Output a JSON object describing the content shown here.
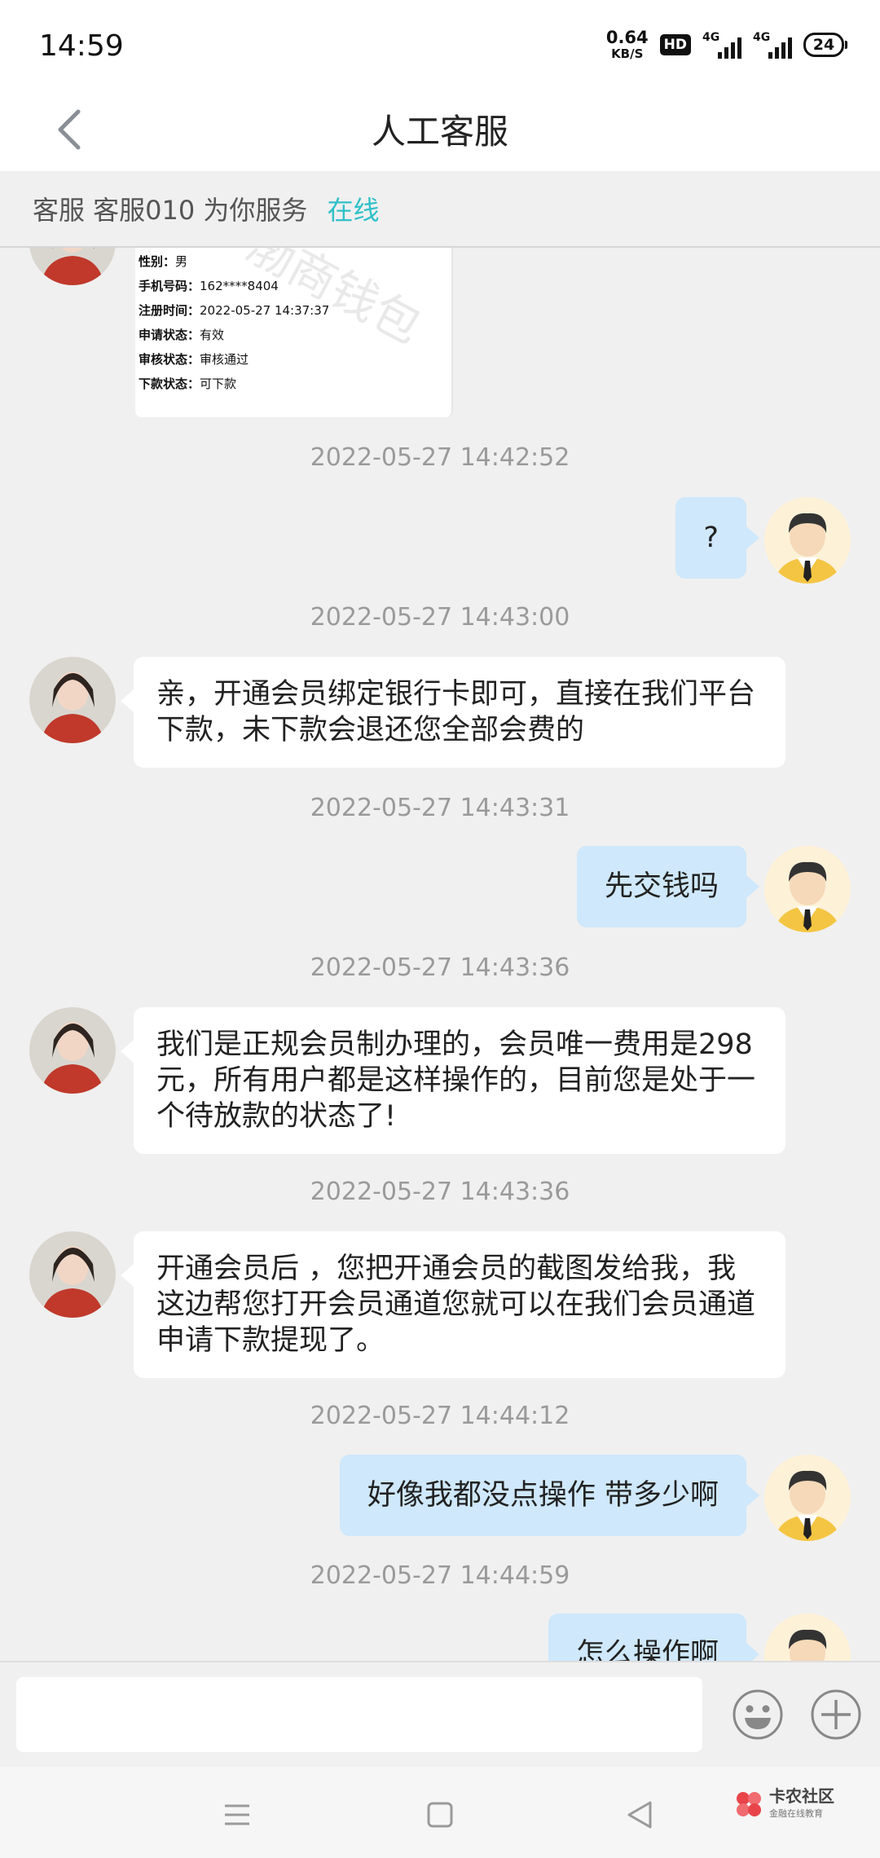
{
  "status_bar": {
    "time": "14:59",
    "net_speed_value": "0.64",
    "net_speed_unit": "KB/S",
    "hd_badge": "HD",
    "signal1_label": "4G",
    "signal2_label": "4G",
    "battery": "24"
  },
  "header": {
    "title": "人工客服"
  },
  "service_bar": {
    "text": "客服 客服010 为你服务",
    "status": "在线"
  },
  "screenshot_card": {
    "watermark": "渤商钱包",
    "rows": [
      {
        "label": "性别：",
        "value": "男"
      },
      {
        "label": "手机号码：",
        "value": "162****8404"
      },
      {
        "label": "注册时间：",
        "value": "2022-05-27 14:37:37"
      },
      {
        "label": "申请状态：",
        "value": "有效"
      },
      {
        "label": "审核状态：",
        "value": "审核通过"
      },
      {
        "label": "下款状态：",
        "value": "可下款"
      }
    ]
  },
  "messages": [
    {
      "time": "2022-05-27 14:42:52",
      "sender": "user",
      "text": "?"
    },
    {
      "time": "2022-05-27 14:43:00",
      "sender": "agent",
      "text": "亲，开通会员绑定银行卡即可，直接在我们平台下款，未下款会退还您全部会费的"
    },
    {
      "time": "2022-05-27 14:43:31",
      "sender": "user",
      "text": "先交钱吗"
    },
    {
      "time": "2022-05-27 14:43:36",
      "sender": "agent",
      "text": "我们是正规会员制办理的，会员唯一费用是298元，所有用户都是这样操作的，目前您是处于一个待放款的状态了!"
    },
    {
      "time": "2022-05-27 14:43:36",
      "sender": "agent",
      "text": "开通会员后 ，您把开通会员的截图发给我，我这边帮您打开会员通道您就可以在我们会员通道申请下款提现了。"
    },
    {
      "time": "2022-05-27 14:44:12",
      "sender": "user",
      "text": "好像我都没点操作 带多少啊"
    },
    {
      "time": "2022-05-27 14:44:59",
      "sender": "user",
      "text": "怎么操作啊"
    }
  ],
  "input_bar": {
    "placeholder": "",
    "emoji_icon": "emoji-icon",
    "plus_icon": "plus-icon"
  },
  "watermark_brand": {
    "name": "卡农社区",
    "sub": "金融在线教育"
  },
  "colors": {
    "online": "#2fc0c8",
    "user_bubble": "#cfe8fb",
    "agent_bubble": "#ffffff",
    "background": "#f0f0f0"
  }
}
